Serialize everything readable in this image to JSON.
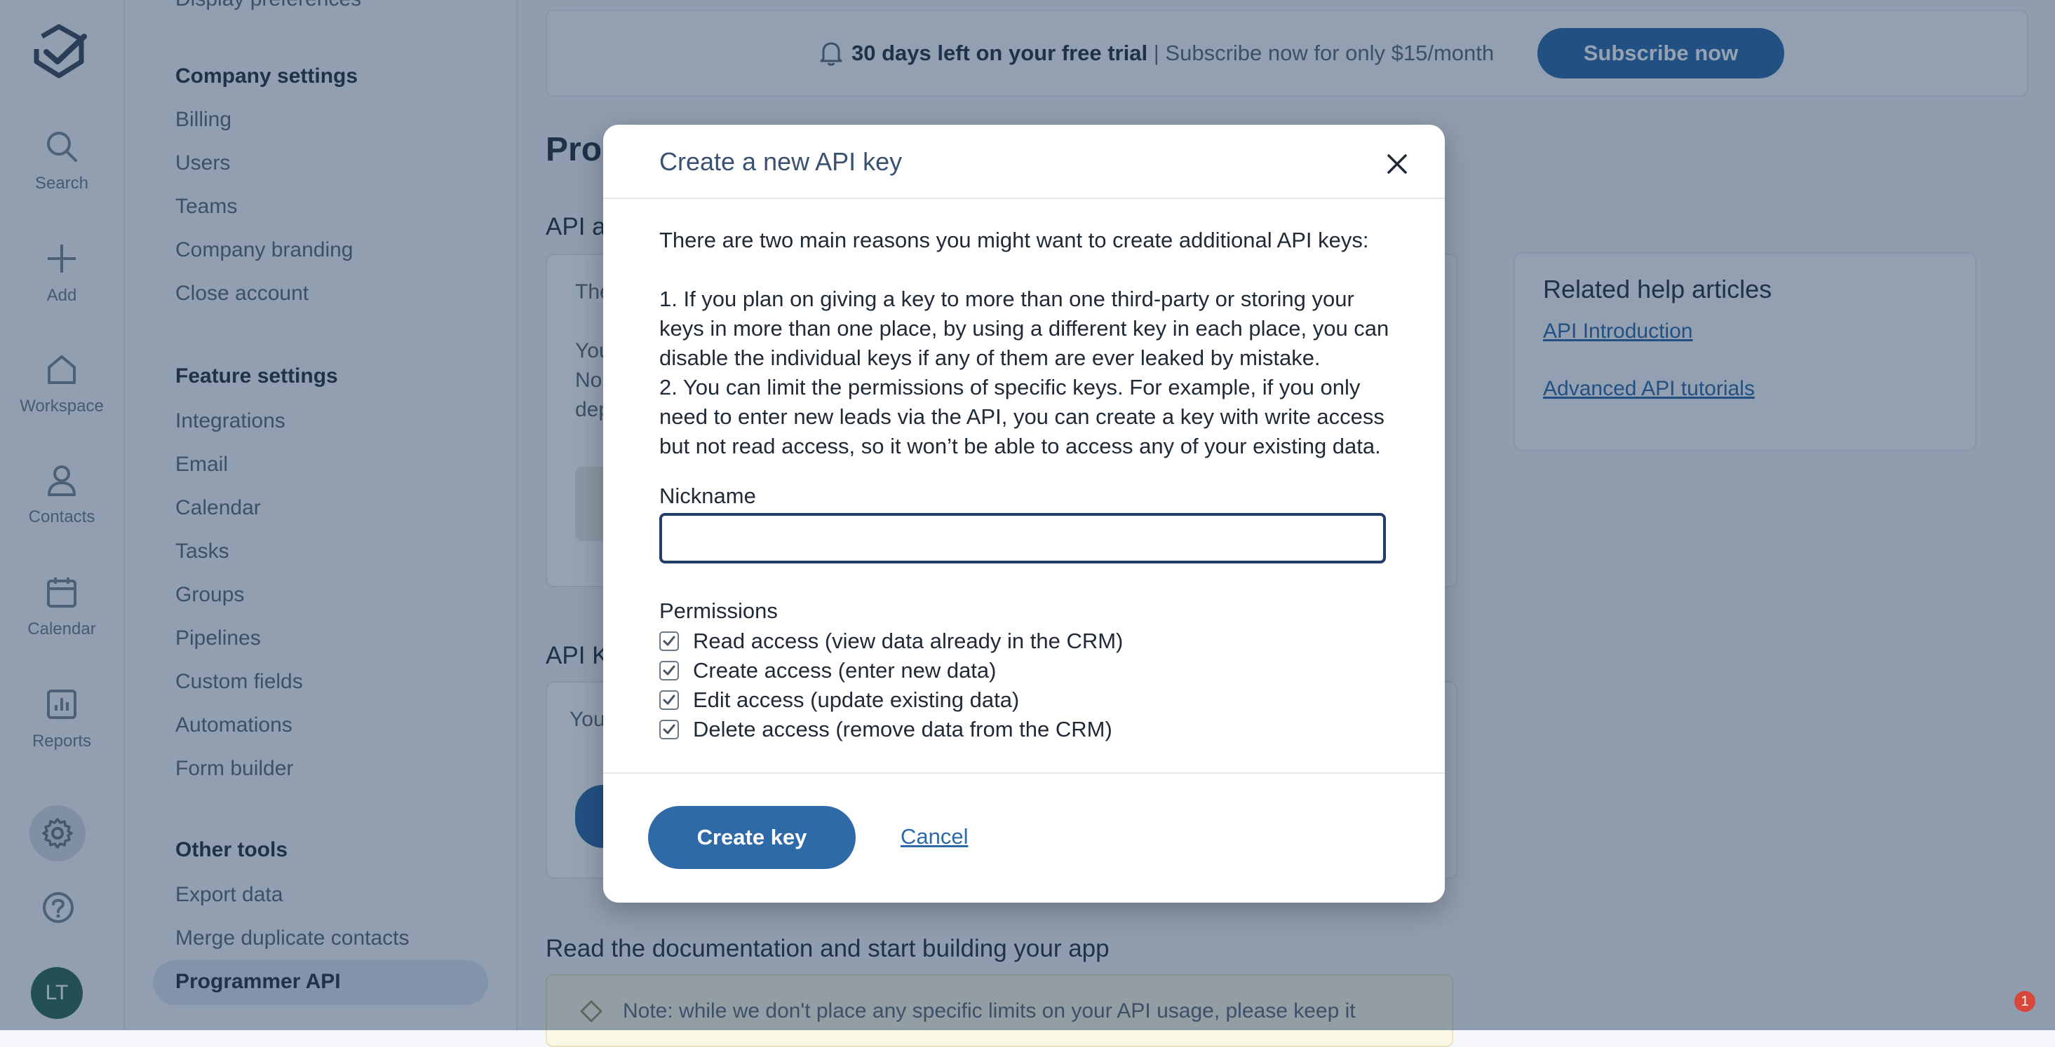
{
  "rail": {
    "items": [
      {
        "label": "Search",
        "icon": "search-icon"
      },
      {
        "label": "Add",
        "icon": "plus-icon"
      },
      {
        "label": "Workspace",
        "icon": "home-icon"
      },
      {
        "label": "Contacts",
        "icon": "person-icon"
      },
      {
        "label": "Calendar",
        "icon": "calendar-icon"
      },
      {
        "label": "Reports",
        "icon": "chart-icon"
      }
    ],
    "avatar_initials": "LT"
  },
  "settings": {
    "top_partial": "Display preferences",
    "company_heading": "Company settings",
    "company_items": [
      "Billing",
      "Users",
      "Teams",
      "Company branding",
      "Close account"
    ],
    "feature_heading": "Feature settings",
    "feature_items": [
      "Integrations",
      "Email",
      "Calendar",
      "Tasks",
      "Groups",
      "Pipelines",
      "Custom fields",
      "Automations",
      "Form builder"
    ],
    "other_heading": "Other tools",
    "other_items": [
      "Export data",
      "Merge duplicate contacts",
      "Programmer API"
    ]
  },
  "trial_banner": {
    "bold": "30 days left on your free trial",
    "separator": "|",
    "rest": "Subscribe now for only $15/month",
    "button": "Subscribe now"
  },
  "background": {
    "page_title_partial": "Prog",
    "api_access_partial": "API a",
    "card_line1": "The",
    "card_line2": "You",
    "card_line3": "No",
    "card_line4": "dep",
    "api_keys_partial": "API K",
    "keys_card_text": "You",
    "docs_heading": "Read the documentation and start building your app",
    "note_text": "Note: while we don't place any specific limits on your API usage, please keep it",
    "notification_count": "1"
  },
  "help_box": {
    "title": "Related help articles",
    "links": [
      "API Introduction",
      "Advanced API tutorials"
    ]
  },
  "modal": {
    "title": "Create a new API key",
    "intro": "There are two main reasons you might want to create additional API keys:",
    "reason1": "1. If you plan on giving a key to more than one third-party or storing your keys in more than one place, by using a different key in each place, you can disable the individual keys if any of them are ever leaked by mistake.",
    "reason2": "2. You can limit the permissions of specific keys. For example, if you only need to enter new leads via the API, you can create a key with write access but not read access, so it won’t be able to access any of your existing data.",
    "nickname_label": "Nickname",
    "nickname_value": "",
    "permissions_label": "Permissions",
    "permissions": [
      {
        "label": "Read access (view data already in the CRM)",
        "checked": true
      },
      {
        "label": "Create access (enter new data)",
        "checked": true
      },
      {
        "label": "Edit access (update existing data)",
        "checked": true
      },
      {
        "label": "Delete access (remove data from the CRM)",
        "checked": true
      }
    ],
    "create_button": "Create key",
    "cancel_link": "Cancel"
  },
  "colors": {
    "accent": "#2f6aa8",
    "overlay": "#143054",
    "input_border": "#1f3f66",
    "avatar_bg": "#2f6a55",
    "badge": "#d5483a"
  }
}
